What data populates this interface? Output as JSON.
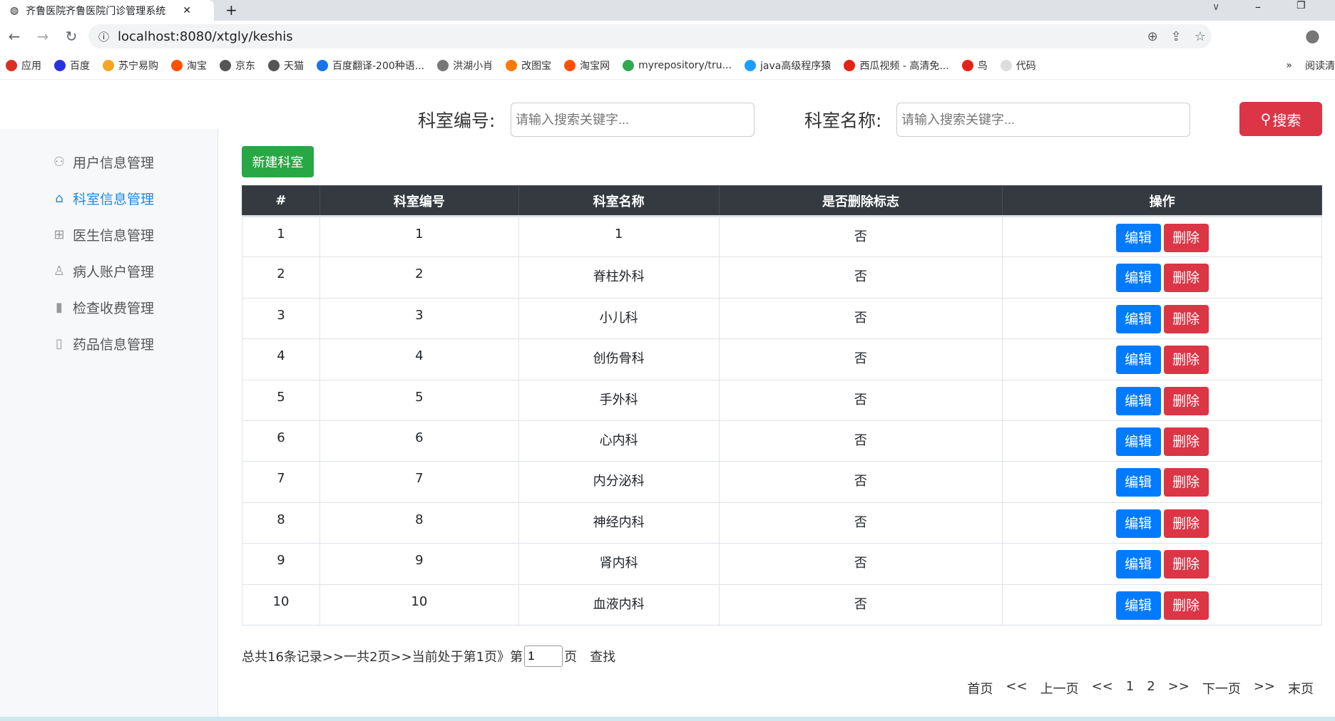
{
  "browser": {
    "tab_title": "齐鲁医院齐鲁医院门诊管理系统",
    "url": "localhost:8080/xtgly/keshis",
    "bookmarks": [
      "应用",
      "百度",
      "苏宁易购",
      "淘宝",
      "京东",
      "天猫",
      "百度翻译-200种语...",
      "洪湖小肖",
      "改图宝",
      "淘宝网",
      "myrepository/tru...",
      "java高级程序猿",
      "西瓜视频 - 高清免...",
      "鸟",
      "代码"
    ],
    "reading_list": "阅读清"
  },
  "search": {
    "label1": "科室编号:",
    "placeholder1": "请输入搜索关键字...",
    "label2": "科室名称:",
    "placeholder2": "请输入搜索关键字...",
    "button": "搜索"
  },
  "sidebar": {
    "items": [
      {
        "label": "用户信息管理",
        "icon": "users-icon"
      },
      {
        "label": "科室信息管理",
        "icon": "home-icon",
        "active": true
      },
      {
        "label": "医生信息管理",
        "icon": "gift-icon"
      },
      {
        "label": "病人账户管理",
        "icon": "user-icon"
      },
      {
        "label": "检查收费管理",
        "icon": "bar-chart-icon"
      },
      {
        "label": "药品信息管理",
        "icon": "file-icon"
      }
    ]
  },
  "new_button": "新建科室",
  "table": {
    "headers": [
      "#",
      "科室编号",
      "科室名称",
      "是否删除标志",
      "操作"
    ],
    "rows": [
      [
        "1",
        "1",
        "1",
        "否"
      ],
      [
        "2",
        "2",
        "脊柱外科",
        "否"
      ],
      [
        "3",
        "3",
        "小儿科",
        "否"
      ],
      [
        "4",
        "4",
        "创伤骨科",
        "否"
      ],
      [
        "5",
        "5",
        "手外科",
        "否"
      ],
      [
        "6",
        "6",
        "心内科",
        "否"
      ],
      [
        "7",
        "7",
        "内分泌科",
        "否"
      ],
      [
        "8",
        "8",
        "神经内科",
        "否"
      ],
      [
        "9",
        "9",
        "肾内科",
        "否"
      ],
      [
        "10",
        "10",
        "血液内科",
        "否"
      ]
    ],
    "edit": "编辑",
    "delete": "删除"
  },
  "pagination": {
    "summary": "总共16条记录>>一共2页>>当前处于第1页》第",
    "page_value": "1",
    "page_suffix": "页",
    "find": "查找",
    "links": [
      "首页",
      "<<",
      "上一页",
      "<<",
      "1",
      "2",
      ">>",
      "下一页",
      ">>",
      "末页"
    ]
  },
  "colors": {
    "primary": "#007bff",
    "danger": "#dc3545",
    "success": "#28a745",
    "header": "#343a40",
    "active": "#1e88e5"
  }
}
